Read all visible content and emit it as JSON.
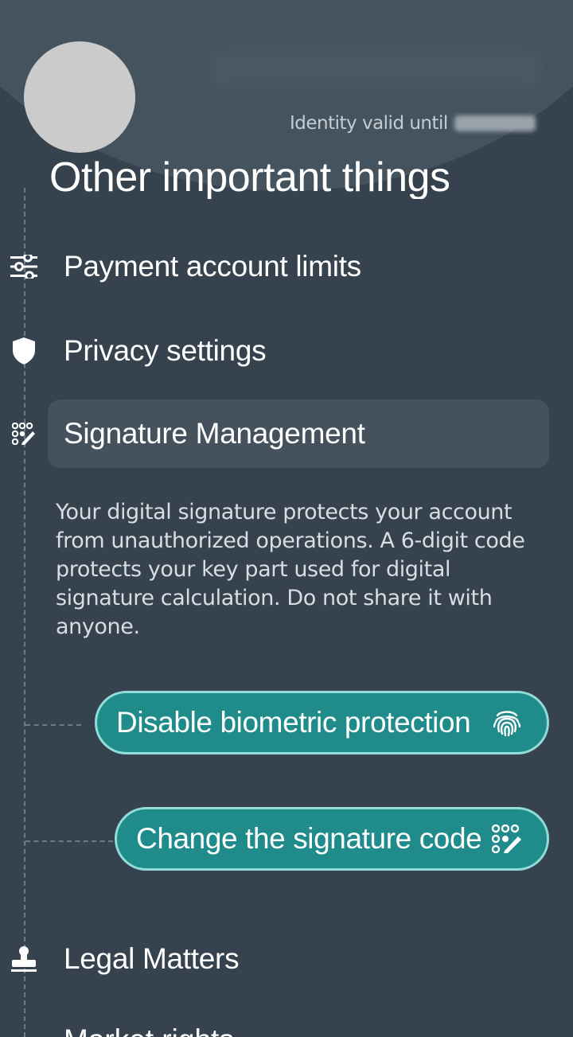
{
  "profile": {
    "identity_label": "Identity valid until"
  },
  "section": {
    "title": "Other important things"
  },
  "menu": {
    "items": [
      {
        "label": "Payment account limits",
        "icon": "sliders-icon"
      },
      {
        "label": "Privacy settings",
        "icon": "shield-icon"
      },
      {
        "label": "Signature Management",
        "icon": "keypad-pen-icon"
      },
      {
        "label": "Legal Matters",
        "icon": "stamp-icon"
      }
    ],
    "next_item_partial": "Market rights"
  },
  "signature": {
    "description": "Your digital signature protects your account from unauthorized operations. A 6-digit code protects your key part used for digital signature calculation. Do not share it with anyone.",
    "buttons": {
      "disable_biometric": "Disable biometric protection",
      "change_code": "Change the signature code"
    }
  },
  "colors": {
    "background": "#36434f",
    "header": "#45535f",
    "accent": "#1f8b8b",
    "accent_border": "#92dcd8"
  }
}
